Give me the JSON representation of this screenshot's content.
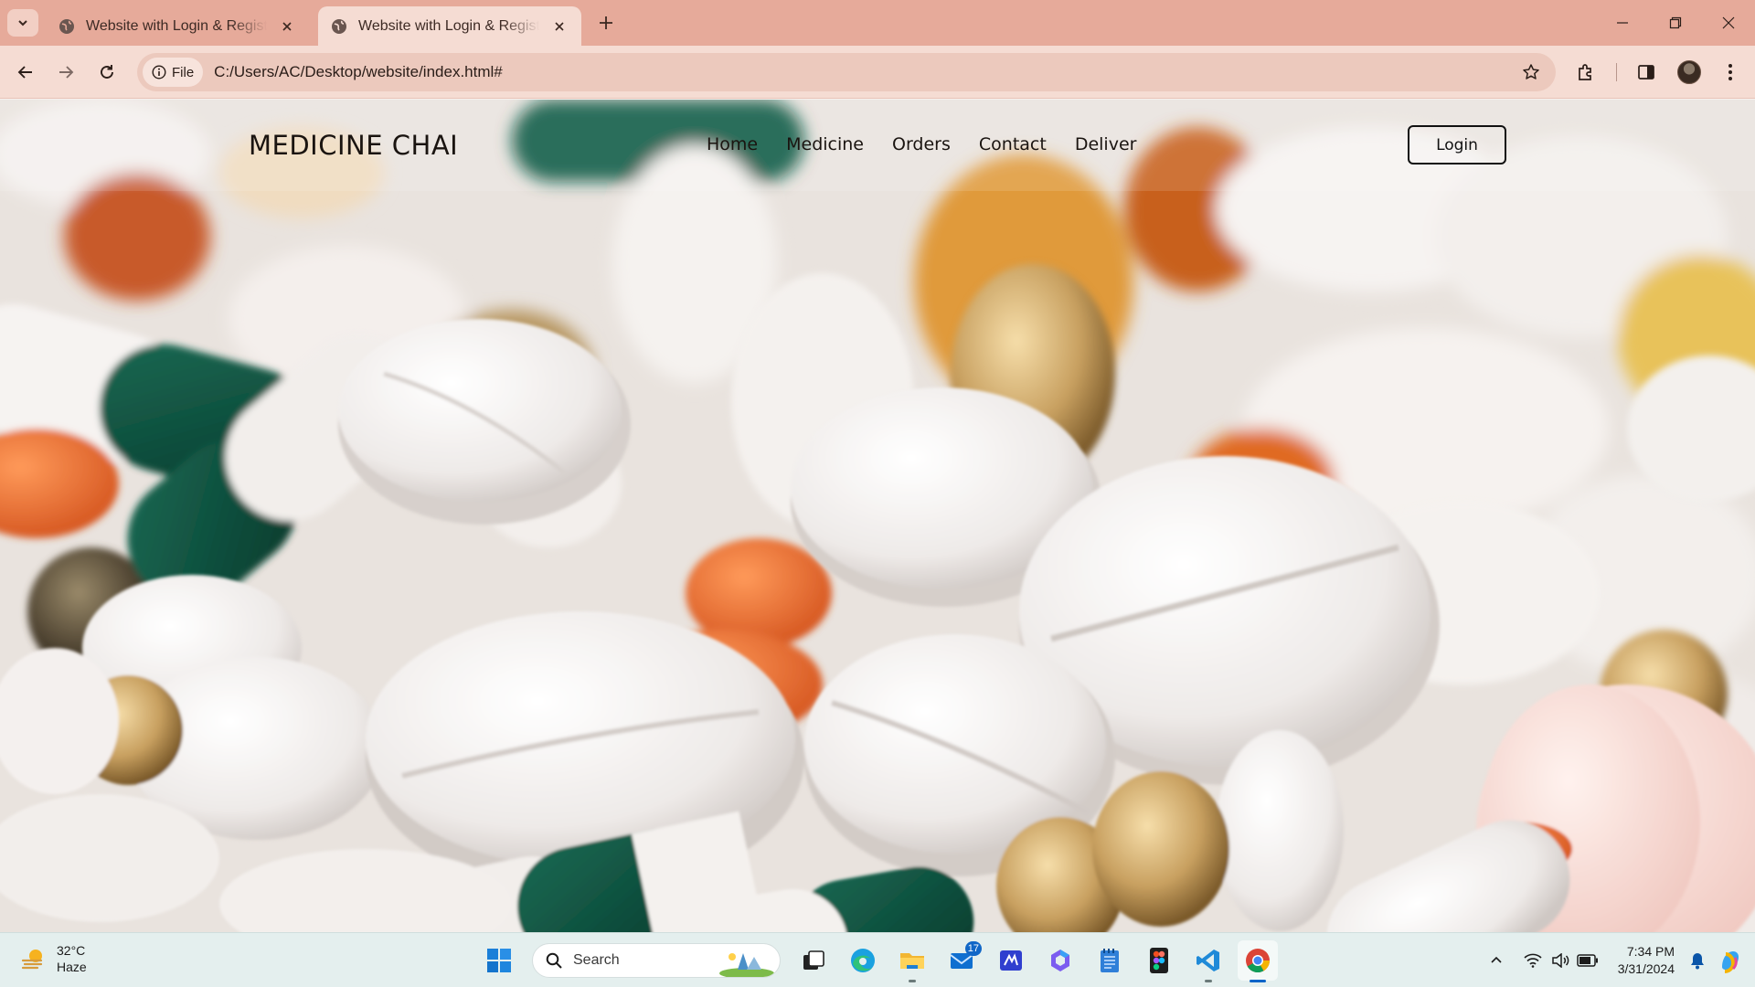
{
  "browser": {
    "tabs": [
      {
        "title": "Website with Login & Registration",
        "active": false
      },
      {
        "title": "Website with Login & Registration",
        "active": true
      }
    ],
    "address": {
      "scheme_label": "File",
      "url": "C:/Users/AC/Desktop/website/index.html#"
    },
    "colors": {
      "frame": "#e6aa9a",
      "toolbar": "#f5dcd3",
      "omnibox": "#ecc9bd"
    }
  },
  "site": {
    "logo": "MEDICINE CHAI",
    "nav": [
      "Home",
      "Medicine",
      "Orders",
      "Contact",
      "Deliver"
    ],
    "login_label": "Login",
    "background": "close-up photo of white tablets, green-and-white capsules, orange pills and amber softgels"
  },
  "taskbar": {
    "weather": {
      "temp": "32°C",
      "condition": "Haze"
    },
    "search_placeholder": "Search",
    "apps": [
      "windows-start",
      "task-view",
      "edge",
      "file-explorer",
      "mail",
      "whiteboard",
      "copilot",
      "notepad",
      "figma",
      "vscode",
      "chrome"
    ],
    "mail_badge": "17",
    "clock": {
      "time": "7:34 PM",
      "date": "3/31/2024"
    }
  }
}
